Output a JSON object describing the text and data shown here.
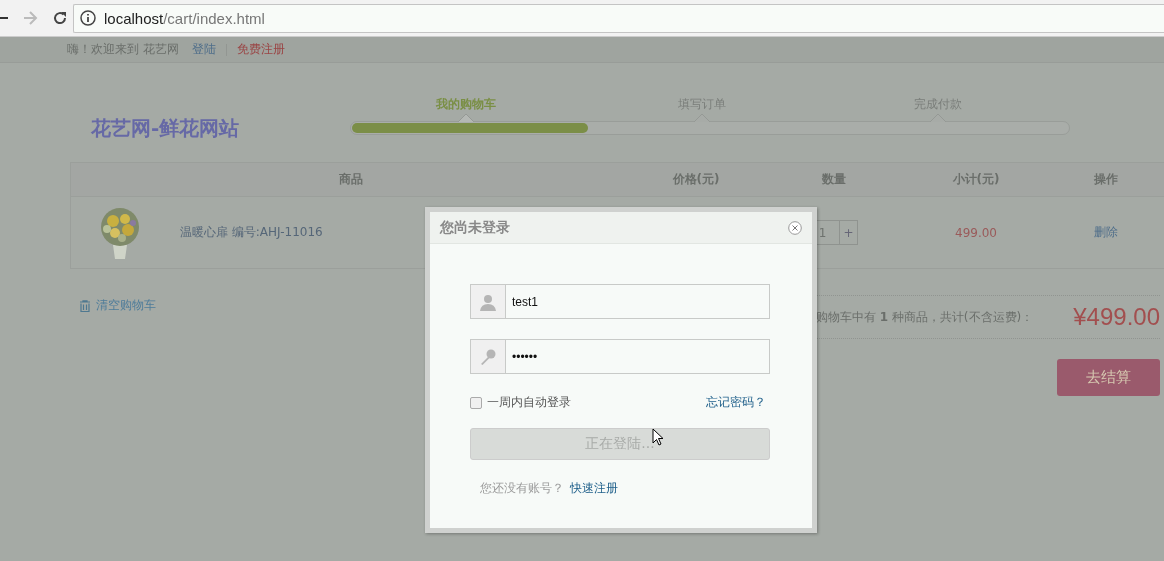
{
  "browser": {
    "url_host": "localhost",
    "url_path": "/cart/index.html"
  },
  "top_bar": {
    "greeting": "嗨！欢迎来到 花艺网",
    "links": [
      {
        "label": "登陆",
        "kind": "login"
      },
      {
        "label": "免费注册",
        "kind": "register"
      }
    ]
  },
  "header": {
    "logo": "花艺网-鲜花网站",
    "steps": [
      {
        "label": "我的购物车",
        "selected": true
      },
      {
        "label": "填写订单",
        "selected": false
      },
      {
        "label": "完成付款",
        "selected": false
      }
    ],
    "progress": {
      "level": 0.33
    }
  },
  "cart": {
    "columns": [
      "商品",
      "价格(元)",
      "数量",
      "小计(元)",
      "操作"
    ],
    "rows": [
      {
        "name": "温暖心扉 编号:AHJ-11016",
        "quantity": "1",
        "increment": "+",
        "subtotal": "499.00",
        "action": "删除"
      }
    ]
  },
  "clear_cart": "清空购物车",
  "summary": {
    "text": "购物车中有 **1** 种商品，共计(不含运费)：",
    "total": "¥499.00"
  },
  "checkout_button": "去结算",
  "login_dialog": {
    "title": "您尚未登录",
    "username": {
      "value": "test1"
    },
    "password": {
      "value": "••••••"
    },
    "remember": {
      "label": "一周内自动登录",
      "checked": false
    },
    "forgot_link": "忘记密码？",
    "submit": {
      "label": "正在登陆...",
      "disabled": true
    },
    "signup_prompt": "您还没有账号？",
    "signup_link": "快速注册"
  }
}
